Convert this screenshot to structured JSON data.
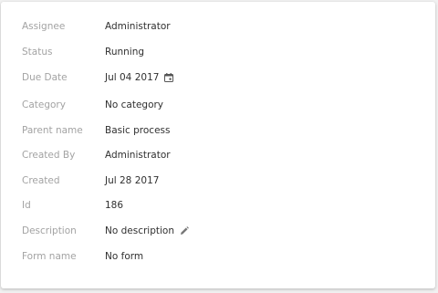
{
  "details": {
    "assignee": {
      "label": "Assignee",
      "value": "Administrator"
    },
    "status": {
      "label": "Status",
      "value": "Running"
    },
    "due_date": {
      "label": "Due Date",
      "value": "Jul 04 2017",
      "icon": "calendar-icon"
    },
    "category": {
      "label": "Category",
      "value": "No category"
    },
    "parent_name": {
      "label": "Parent name",
      "value": "Basic process"
    },
    "created_by": {
      "label": "Created By",
      "value": "Administrator"
    },
    "created": {
      "label": "Created",
      "value": "Jul 28 2017"
    },
    "id": {
      "label": "Id",
      "value": "186"
    },
    "description": {
      "label": "Description",
      "value": "No description",
      "icon": "pencil-icon"
    },
    "form_name": {
      "label": "Form name",
      "value": "No form"
    }
  },
  "colors": {
    "label": "#a3a3a3",
    "value": "#303030",
    "icon": "#666666"
  }
}
